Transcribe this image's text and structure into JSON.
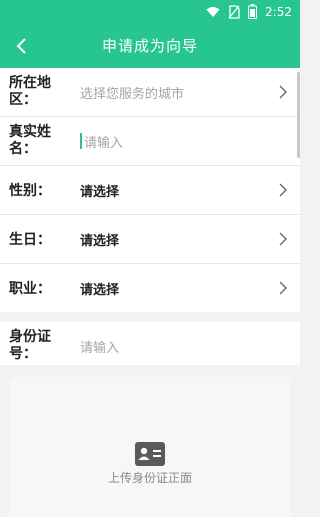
{
  "status_bar": {
    "time": "2:52",
    "icons": [
      "wifi-icon",
      "no-sim-icon",
      "battery-icon"
    ]
  },
  "app_bar": {
    "title": "申请成为向导",
    "back_icon": "back-chevron-icon",
    "color": "#27c58f"
  },
  "form": {
    "fields": [
      {
        "label": "所在地区：",
        "value": "选择您服务的城市",
        "is_placeholder": true,
        "has_chevron": true
      },
      {
        "label": "真实姓名：",
        "value": "请输入",
        "is_placeholder": true,
        "has_chevron": false
      },
      {
        "label": "性别：",
        "value": "请选择",
        "is_placeholder": false,
        "has_chevron": true
      },
      {
        "label": "生日：",
        "value": "请选择",
        "is_placeholder": false,
        "has_chevron": true
      },
      {
        "label": "职业：",
        "value": "请选择",
        "is_placeholder": false,
        "has_chevron": true
      }
    ],
    "id_field": {
      "label": "身份证号：",
      "placeholder": "请输入"
    }
  },
  "upload": {
    "label": "上传身份证正面",
    "icon": "id-card-icon"
  }
}
